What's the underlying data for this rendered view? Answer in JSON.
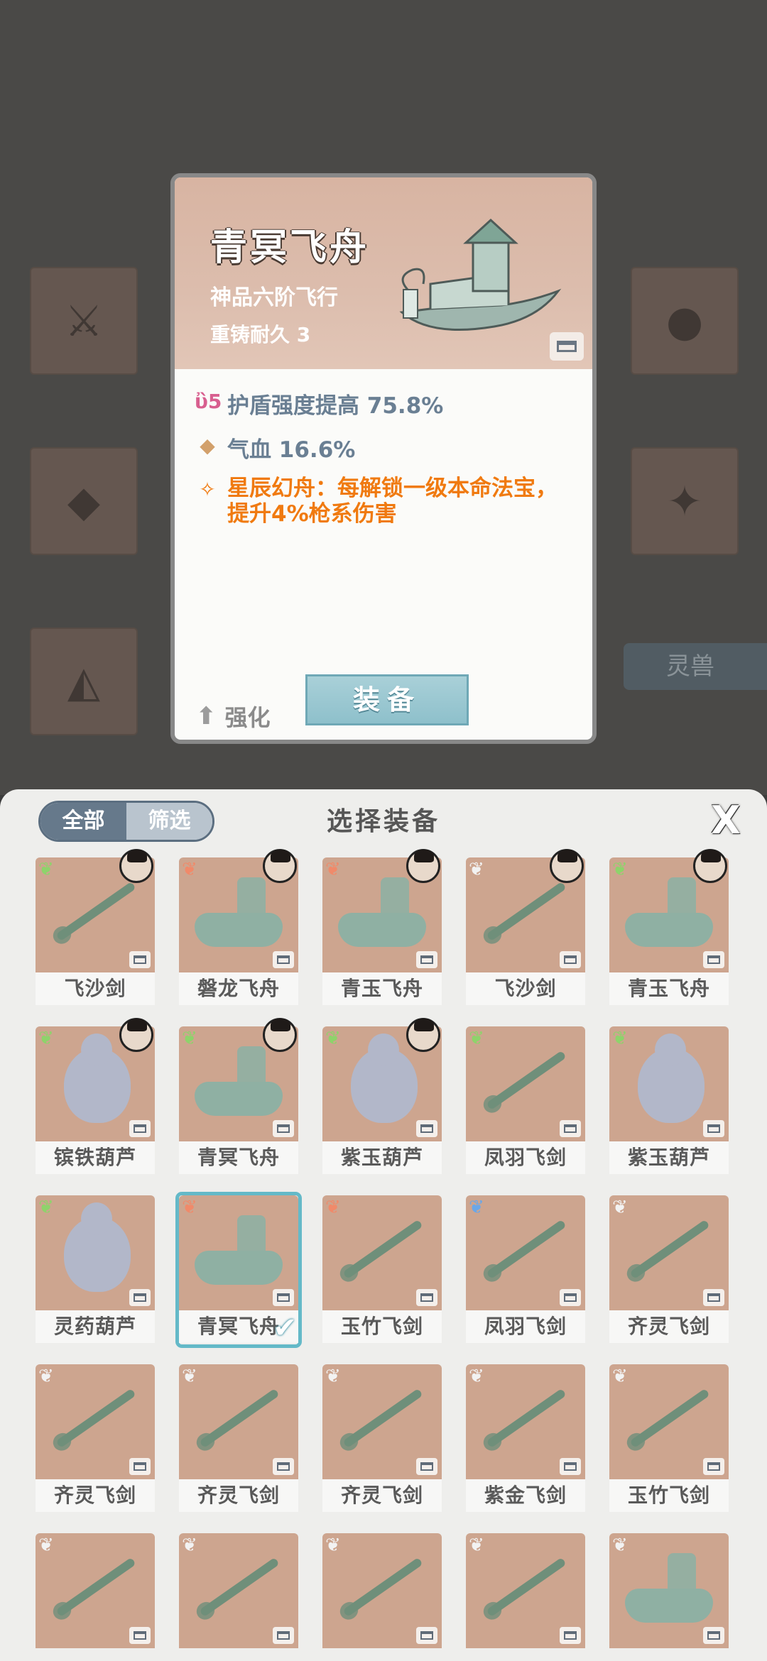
{
  "detail": {
    "name": "青冥飞舟",
    "grade": "神品六阶飞行",
    "durability": "重铸耐久 3",
    "attributes": [
      {
        "icon": "shield-icon",
        "text": "护盾强度提高 75.8%"
      },
      {
        "icon": "diamond-icon",
        "text": "气血 16.6%"
      },
      {
        "icon": "rune-icon",
        "text": "星辰幻舟：每解锁一级本命法宝，提升4%枪系伤害"
      }
    ],
    "enhance_label": "强化",
    "equip_label": "装备"
  },
  "background": {
    "spirit_beast_tab": "灵兽"
  },
  "panel": {
    "tab_all": "全部",
    "tab_filter": "筛选",
    "title": "选择装备",
    "close": "X"
  },
  "colors": {
    "accent_teal": "#64b9c8",
    "special_orange": "#f07a10",
    "attr_blue": "#6a7f93",
    "tile_bg": "#cda58f"
  },
  "items": [
    {
      "name": "飞沙剑",
      "kind": "sword",
      "wing": "#8ed36b",
      "portrait": true
    },
    {
      "name": "磐龙飞舟",
      "kind": "boat",
      "wing": "#f08a6a",
      "portrait": true
    },
    {
      "name": "青玉飞舟",
      "kind": "boat",
      "wing": "#f08a6a",
      "portrait": true
    },
    {
      "name": "飞沙剑",
      "kind": "sword",
      "wing": "#f2f2f2",
      "portrait": true
    },
    {
      "name": "青玉飞舟",
      "kind": "boat",
      "wing": "#8ed36b",
      "portrait": true
    },
    {
      "name": "镔铁葫芦",
      "kind": "gourd",
      "wing": "#8ed36b",
      "portrait": true
    },
    {
      "name": "青冥飞舟",
      "kind": "boat",
      "wing": "#8ed36b",
      "portrait": true
    },
    {
      "name": "紫玉葫芦",
      "kind": "gourd",
      "wing": "#8ed36b",
      "portrait": true
    },
    {
      "name": "凤羽飞剑",
      "kind": "sword",
      "wing": "#8ed36b",
      "portrait": false
    },
    {
      "name": "紫玉葫芦",
      "kind": "gourd",
      "wing": "#8ed36b",
      "portrait": false
    },
    {
      "name": "灵药葫芦",
      "kind": "gourd",
      "wing": "#8ed36b",
      "portrait": false
    },
    {
      "name": "青冥飞舟",
      "kind": "boat",
      "wing": "#f08a6a",
      "portrait": false,
      "selected": true
    },
    {
      "name": "玉竹飞剑",
      "kind": "sword",
      "wing": "#f08a6a",
      "portrait": false
    },
    {
      "name": "凤羽飞剑",
      "kind": "sword",
      "wing": "#6aa7e8",
      "portrait": false
    },
    {
      "name": "齐灵飞剑",
      "kind": "sword",
      "wing": "#f2f2f2",
      "portrait": false
    },
    {
      "name": "齐灵飞剑",
      "kind": "sword",
      "wing": "#f2f2f2",
      "portrait": false
    },
    {
      "name": "齐灵飞剑",
      "kind": "sword",
      "wing": "#f2f2f2",
      "portrait": false
    },
    {
      "name": "齐灵飞剑",
      "kind": "sword",
      "wing": "#f2f2f2",
      "portrait": false
    },
    {
      "name": "紫金飞剑",
      "kind": "sword",
      "wing": "#f2f2f2",
      "portrait": false
    },
    {
      "name": "玉竹飞剑",
      "kind": "sword",
      "wing": "#f2f2f2",
      "portrait": false
    },
    {
      "name": "",
      "kind": "sword",
      "wing": "#f2f2f2",
      "portrait": false
    },
    {
      "name": "",
      "kind": "sword",
      "wing": "#f2f2f2",
      "portrait": false
    },
    {
      "name": "",
      "kind": "sword",
      "wing": "#f2f2f2",
      "portrait": false
    },
    {
      "name": "",
      "kind": "sword",
      "wing": "#f2f2f2",
      "portrait": false
    },
    {
      "name": "",
      "kind": "boat",
      "wing": "#f2f2f2",
      "portrait": false
    }
  ]
}
